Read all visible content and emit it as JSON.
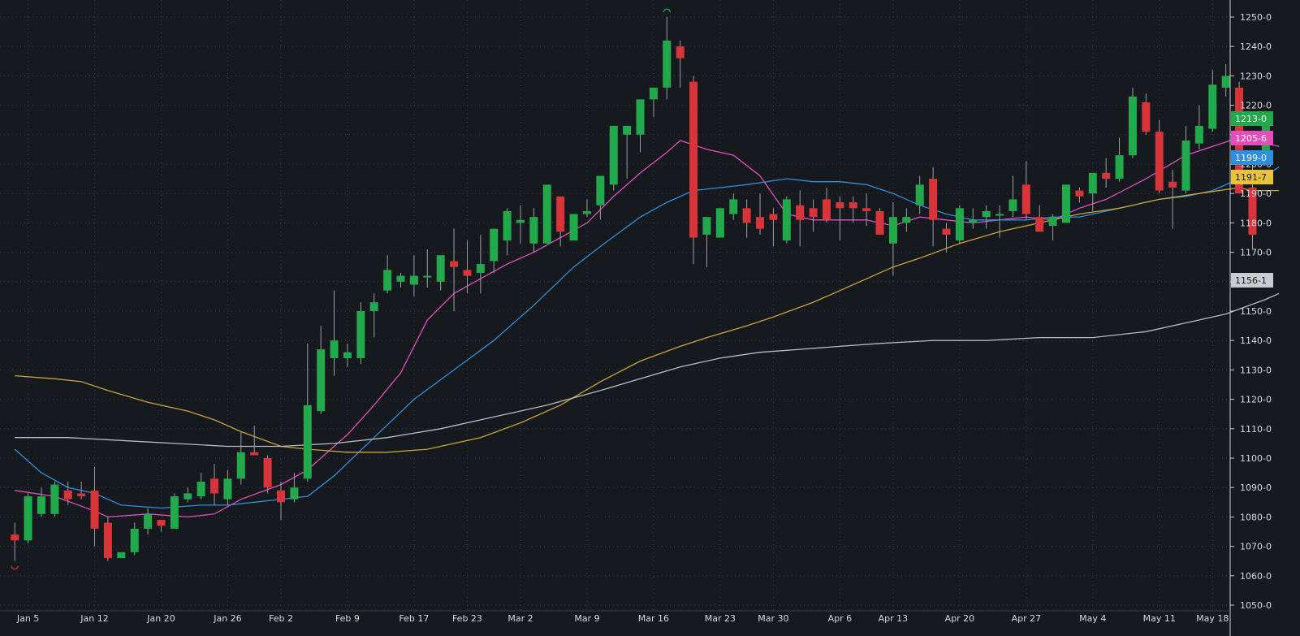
{
  "chart_data": {
    "type": "candlestick",
    "x_tick_labels": [
      "Jan 5",
      "Jan 12",
      "Jan 20",
      "Jan 26",
      "Feb 2",
      "Feb 9",
      "Feb 17",
      "Feb 23",
      "Mar 2",
      "Mar 9",
      "Mar 16",
      "Mar 23",
      "Mar 30",
      "Apr 6",
      "Apr 13",
      "Apr 20",
      "Apr 27",
      "May 4",
      "May 11",
      "May 18"
    ],
    "y_tick_labels": [
      "1250-0",
      "1240-0",
      "1230-0",
      "1220-0",
      "1210-0",
      "1200-0",
      "1190-0",
      "1180-0",
      "1170-0",
      "1160-0",
      "1150-0",
      "1140-0",
      "1130-0",
      "1120-0",
      "1110-0",
      "1100-0",
      "1090-0",
      "1080-0",
      "1070-0",
      "1060-0",
      "1050-0"
    ],
    "ylim": [
      1050,
      1253
    ],
    "grid": true,
    "colors": {
      "up": "#21a94b",
      "down": "#d9343a",
      "background": "#161a1e"
    },
    "candles": [
      {
        "o": 1074,
        "h": 1078,
        "l": 1065,
        "c": 1072
      },
      {
        "o": 1072,
        "h": 1088,
        "l": 1071,
        "c": 1087
      },
      {
        "o": 1081,
        "h": 1090,
        "l": 1080,
        "c": 1087
      },
      {
        "o": 1081,
        "h": 1092,
        "l": 1080,
        "c": 1091
      },
      {
        "o": 1089,
        "h": 1092,
        "l": 1084,
        "c": 1086
      },
      {
        "o": 1088,
        "h": 1092,
        "l": 1086,
        "c": 1087
      },
      {
        "o": 1089,
        "h": 1097,
        "l": 1070,
        "c": 1076
      },
      {
        "o": 1078,
        "h": 1080,
        "l": 1065,
        "c": 1066
      },
      {
        "o": 1066,
        "h": 1068,
        "l": 1066,
        "c": 1068
      },
      {
        "o": 1068,
        "h": 1078,
        "l": 1067,
        "c": 1076
      },
      {
        "o": 1076,
        "h": 1083,
        "l": 1074,
        "c": 1081
      },
      {
        "o": 1079,
        "h": 1079,
        "l": 1075,
        "c": 1077
      },
      {
        "o": 1076,
        "h": 1088,
        "l": 1076,
        "c": 1087
      },
      {
        "o": 1086,
        "h": 1090,
        "l": 1085,
        "c": 1088
      },
      {
        "o": 1087,
        "h": 1095,
        "l": 1086,
        "c": 1092
      },
      {
        "o": 1093,
        "h": 1098,
        "l": 1084,
        "c": 1088
      },
      {
        "o": 1086,
        "h": 1096,
        "l": 1084,
        "c": 1093
      },
      {
        "o": 1093,
        "h": 1109,
        "l": 1091,
        "c": 1102
      },
      {
        "o": 1102,
        "h": 1111,
        "l": 1101,
        "c": 1101
      },
      {
        "o": 1100,
        "h": 1101,
        "l": 1088,
        "c": 1090
      },
      {
        "o": 1089,
        "h": 1092,
        "l": 1079,
        "c": 1085
      },
      {
        "o": 1086,
        "h": 1095,
        "l": 1085,
        "c": 1090
      },
      {
        "o": 1093,
        "h": 1139,
        "l": 1092,
        "c": 1118
      },
      {
        "o": 1116,
        "h": 1145,
        "l": 1115,
        "c": 1137
      },
      {
        "o": 1134,
        "h": 1157,
        "l": 1128,
        "c": 1140
      },
      {
        "o": 1134,
        "h": 1139,
        "l": 1131,
        "c": 1136
      },
      {
        "o": 1134,
        "h": 1153,
        "l": 1132,
        "c": 1150
      },
      {
        "o": 1150,
        "h": 1156,
        "l": 1141,
        "c": 1153
      },
      {
        "o": 1157,
        "h": 1169,
        "l": 1156,
        "c": 1164
      },
      {
        "o": 1160,
        "h": 1163,
        "l": 1158,
        "c": 1162
      },
      {
        "o": 1159,
        "h": 1169,
        "l": 1155,
        "c": 1162
      },
      {
        "o": 1162,
        "h": 1171,
        "l": 1158,
        "c": 1162
      },
      {
        "o": 1160,
        "h": 1168,
        "l": 1157,
        "c": 1169
      },
      {
        "o": 1167,
        "h": 1178,
        "l": 1150,
        "c": 1165
      },
      {
        "o": 1164,
        "h": 1174,
        "l": 1156,
        "c": 1162
      },
      {
        "o": 1163,
        "h": 1176,
        "l": 1156,
        "c": 1166
      },
      {
        "o": 1167,
        "h": 1176,
        "l": 1163,
        "c": 1178
      },
      {
        "o": 1174,
        "h": 1185,
        "l": 1169,
        "c": 1184
      },
      {
        "o": 1180,
        "h": 1186,
        "l": 1173,
        "c": 1181
      },
      {
        "o": 1173,
        "h": 1185,
        "l": 1170,
        "c": 1182
      },
      {
        "o": 1173,
        "h": 1188,
        "l": 1173,
        "c": 1193
      },
      {
        "o": 1189,
        "h": 1189,
        "l": 1172,
        "c": 1177
      },
      {
        "o": 1174,
        "h": 1183,
        "l": 1174,
        "c": 1183
      },
      {
        "o": 1183,
        "h": 1188,
        "l": 1182,
        "c": 1184
      },
      {
        "o": 1186,
        "h": 1194,
        "l": 1181,
        "c": 1196
      },
      {
        "o": 1193,
        "h": 1206,
        "l": 1191,
        "c": 1213
      },
      {
        "o": 1210,
        "h": 1212,
        "l": 1195,
        "c": 1213
      },
      {
        "o": 1210,
        "h": 1214,
        "l": 1204,
        "c": 1222
      },
      {
        "o": 1222,
        "h": 1225,
        "l": 1216,
        "c": 1226
      },
      {
        "o": 1226,
        "h": 1250,
        "l": 1222,
        "c": 1242
      },
      {
        "o": 1240,
        "h": 1242,
        "l": 1226,
        "c": 1236
      },
      {
        "o": 1228,
        "h": 1230,
        "l": 1166,
        "c": 1175
      },
      {
        "o": 1176,
        "h": 1180,
        "l": 1165,
        "c": 1182
      },
      {
        "o": 1175,
        "h": 1183,
        "l": 1175,
        "c": 1185
      },
      {
        "o": 1183,
        "h": 1190,
        "l": 1181,
        "c": 1188
      },
      {
        "o": 1185,
        "h": 1188,
        "l": 1175,
        "c": 1180
      },
      {
        "o": 1182,
        "h": 1190,
        "l": 1176,
        "c": 1178
      },
      {
        "o": 1183,
        "h": 1185,
        "l": 1172,
        "c": 1181
      },
      {
        "o": 1174,
        "h": 1189,
        "l": 1173,
        "c": 1188
      },
      {
        "o": 1186,
        "h": 1191,
        "l": 1172,
        "c": 1181
      },
      {
        "o": 1185,
        "h": 1188,
        "l": 1177,
        "c": 1182
      },
      {
        "o": 1188,
        "h": 1192,
        "l": 1180,
        "c": 1181
      },
      {
        "o": 1187,
        "h": 1189,
        "l": 1174,
        "c": 1185
      },
      {
        "o": 1187,
        "h": 1189,
        "l": 1180,
        "c": 1185
      },
      {
        "o": 1185,
        "h": 1190,
        "l": 1179,
        "c": 1184
      },
      {
        "o": 1184,
        "h": 1185,
        "l": 1176,
        "c": 1176
      },
      {
        "o": 1173,
        "h": 1187,
        "l": 1162,
        "c": 1182
      },
      {
        "o": 1180,
        "h": 1185,
        "l": 1177,
        "c": 1182
      },
      {
        "o": 1186,
        "h": 1196,
        "l": 1183,
        "c": 1193
      },
      {
        "o": 1195,
        "h": 1199,
        "l": 1172,
        "c": 1181
      },
      {
        "o": 1178,
        "h": 1180,
        "l": 1170,
        "c": 1176
      },
      {
        "o": 1174,
        "h": 1186,
        "l": 1173,
        "c": 1185
      },
      {
        "o": 1180,
        "h": 1185,
        "l": 1178,
        "c": 1181
      },
      {
        "o": 1182,
        "h": 1186,
        "l": 1178,
        "c": 1184
      },
      {
        "o": 1183,
        "h": 1186,
        "l": 1175,
        "c": 1183
      },
      {
        "o": 1184,
        "h": 1196,
        "l": 1182,
        "c": 1188
      },
      {
        "o": 1193,
        "h": 1201,
        "l": 1181,
        "c": 1183
      },
      {
        "o": 1182,
        "h": 1186,
        "l": 1177,
        "c": 1177
      },
      {
        "o": 1179,
        "h": 1183,
        "l": 1174,
        "c": 1182
      },
      {
        "o": 1180,
        "h": 1193,
        "l": 1180,
        "c": 1193
      },
      {
        "o": 1191,
        "h": 1192,
        "l": 1187,
        "c": 1189
      },
      {
        "o": 1190,
        "h": 1195,
        "l": 1184,
        "c": 1197
      },
      {
        "o": 1197,
        "h": 1202,
        "l": 1192,
        "c": 1195
      },
      {
        "o": 1195,
        "h": 1209,
        "l": 1194,
        "c": 1203
      },
      {
        "o": 1203,
        "h": 1226,
        "l": 1202,
        "c": 1223
      },
      {
        "o": 1221,
        "h": 1224,
        "l": 1210,
        "c": 1211
      },
      {
        "o": 1211,
        "h": 1215,
        "l": 1190,
        "c": 1191
      },
      {
        "o": 1194,
        "h": 1198,
        "l": 1178,
        "c": 1192
      },
      {
        "o": 1191,
        "h": 1213,
        "l": 1190,
        "c": 1208
      },
      {
        "o": 1207,
        "h": 1220,
        "l": 1205,
        "c": 1213
      },
      {
        "o": 1212,
        "h": 1232,
        "l": 1211,
        "c": 1227
      },
      {
        "o": 1226,
        "h": 1234,
        "l": 1223,
        "c": 1230
      },
      {
        "o": 1226,
        "h": 1228,
        "l": 1190,
        "c": 1190
      },
      {
        "o": 1192,
        "h": 1200,
        "l": 1171,
        "c": 1176
      },
      {
        "o": 1203,
        "h": 1218,
        "l": 1201,
        "c": 1213
      }
    ],
    "candle_x_offset": 0.5,
    "moving_averages": [
      {
        "color": "#e24ebb",
        "points": [
          [
            0,
            1089
          ],
          [
            3,
            1087
          ],
          [
            6,
            1082
          ],
          [
            7,
            1080
          ],
          [
            10,
            1081
          ],
          [
            13,
            1080
          ],
          [
            15,
            1081
          ],
          [
            17,
            1086
          ],
          [
            20,
            1091
          ],
          [
            22,
            1096
          ],
          [
            25,
            1108
          ],
          [
            27,
            1118
          ],
          [
            29,
            1129
          ],
          [
            31,
            1147
          ],
          [
            33,
            1156
          ],
          [
            35,
            1161
          ],
          [
            37,
            1166
          ],
          [
            39,
            1170
          ],
          [
            41,
            1175
          ],
          [
            43,
            1180
          ],
          [
            45,
            1189
          ],
          [
            47,
            1197
          ],
          [
            49,
            1204
          ],
          [
            50,
            1208
          ],
          [
            52,
            1205
          ],
          [
            54,
            1203
          ],
          [
            56,
            1196
          ],
          [
            58,
            1183
          ],
          [
            60,
            1181
          ],
          [
            62,
            1181
          ],
          [
            64,
            1181
          ],
          [
            66,
            1179
          ],
          [
            68,
            1182
          ],
          [
            70,
            1181
          ],
          [
            72,
            1180
          ],
          [
            76,
            1182
          ],
          [
            78,
            1181
          ],
          [
            80,
            1185
          ],
          [
            82,
            1188
          ],
          [
            85,
            1195
          ],
          [
            88,
            1203
          ],
          [
            90,
            1206
          ],
          [
            92,
            1209
          ],
          [
            94,
            1207
          ],
          [
            95,
            1206
          ]
        ]
      },
      {
        "color": "#2e8fdc",
        "points": [
          [
            0,
            1103
          ],
          [
            2,
            1095
          ],
          [
            4,
            1090
          ],
          [
            6,
            1088
          ],
          [
            8,
            1084
          ],
          [
            11,
            1083
          ],
          [
            14,
            1084
          ],
          [
            16,
            1084
          ],
          [
            18,
            1085
          ],
          [
            20,
            1086
          ],
          [
            22,
            1087
          ],
          [
            24,
            1094
          ],
          [
            27,
            1107
          ],
          [
            30,
            1120
          ],
          [
            33,
            1130
          ],
          [
            36,
            1140
          ],
          [
            39,
            1152
          ],
          [
            42,
            1165
          ],
          [
            44,
            1172
          ],
          [
            47,
            1182
          ],
          [
            49,
            1187
          ],
          [
            51,
            1191
          ],
          [
            53,
            1192
          ],
          [
            55,
            1193
          ],
          [
            58,
            1195
          ],
          [
            60,
            1194
          ],
          [
            62,
            1194
          ],
          [
            64,
            1193
          ],
          [
            66,
            1190
          ],
          [
            68,
            1186
          ],
          [
            70,
            1183
          ],
          [
            72,
            1181
          ],
          [
            74,
            1181
          ],
          [
            76,
            1181
          ],
          [
            78,
            1182
          ],
          [
            80,
            1182
          ],
          [
            82,
            1184
          ],
          [
            84,
            1186
          ],
          [
            86,
            1188
          ],
          [
            88,
            1189
          ],
          [
            90,
            1191
          ],
          [
            92,
            1195
          ],
          [
            94,
            1196
          ],
          [
            95,
            1199
          ]
        ]
      },
      {
        "color": "#c9a43a",
        "points": [
          [
            0,
            1128
          ],
          [
            3,
            1127
          ],
          [
            5,
            1126
          ],
          [
            7,
            1123
          ],
          [
            10,
            1119
          ],
          [
            13,
            1116
          ],
          [
            15,
            1113
          ],
          [
            17,
            1109
          ],
          [
            20,
            1104
          ],
          [
            22,
            1103
          ],
          [
            25,
            1102
          ],
          [
            28,
            1102
          ],
          [
            31,
            1103
          ],
          [
            33,
            1105
          ],
          [
            35,
            1107
          ],
          [
            38,
            1112
          ],
          [
            41,
            1118
          ],
          [
            44,
            1126
          ],
          [
            47,
            1133
          ],
          [
            50,
            1138
          ],
          [
            52,
            1141
          ],
          [
            55,
            1145
          ],
          [
            57,
            1148
          ],
          [
            60,
            1153
          ],
          [
            62,
            1157
          ],
          [
            64,
            1161
          ],
          [
            66,
            1165
          ],
          [
            68,
            1168
          ],
          [
            71,
            1173
          ],
          [
            74,
            1177
          ],
          [
            77,
            1180
          ],
          [
            80,
            1183
          ],
          [
            83,
            1185
          ],
          [
            86,
            1188
          ],
          [
            89,
            1190
          ],
          [
            92,
            1192
          ],
          [
            93,
            1191
          ],
          [
            95,
            1191
          ]
        ]
      },
      {
        "color": "#b9bcbf",
        "points": [
          [
            0,
            1107
          ],
          [
            4,
            1107
          ],
          [
            8,
            1106
          ],
          [
            12,
            1105
          ],
          [
            16,
            1104
          ],
          [
            20,
            1104
          ],
          [
            24,
            1105
          ],
          [
            28,
            1107
          ],
          [
            32,
            1110
          ],
          [
            36,
            1114
          ],
          [
            40,
            1118
          ],
          [
            44,
            1123
          ],
          [
            47,
            1127
          ],
          [
            50,
            1131
          ],
          [
            53,
            1134
          ],
          [
            56,
            1136
          ],
          [
            59,
            1137
          ],
          [
            62,
            1138
          ],
          [
            65,
            1139
          ],
          [
            69,
            1140
          ],
          [
            73,
            1140
          ],
          [
            77,
            1141
          ],
          [
            81,
            1141
          ],
          [
            85,
            1143
          ],
          [
            88,
            1146
          ],
          [
            91,
            1149
          ],
          [
            94,
            1154
          ],
          [
            95,
            1156
          ]
        ]
      }
    ],
    "price_tags": [
      {
        "label": "1213-0",
        "value": 1213,
        "bg": "#21a94b",
        "fg": "#ffffff"
      },
      {
        "label": "1205-6",
        "value": 1205.6,
        "bg": "#e24ebb",
        "fg": "#ffffff"
      },
      {
        "label": "1199-0",
        "value": 1199,
        "bg": "#2e8fdc",
        "fg": "#ffffff"
      },
      {
        "label": "1191-7",
        "value": 1191.7,
        "bg": "#e8c23a",
        "fg": "#1a1a1a"
      },
      {
        "label": "1156-1",
        "value": 1156.1,
        "bg": "#c9ccd0",
        "fg": "#1a1a1a"
      }
    ],
    "markers": [
      {
        "type": "low",
        "candle": 0,
        "value": 1065,
        "color": "#d9343a"
      },
      {
        "type": "high",
        "candle": 49,
        "value": 1250,
        "color": "#21a94b"
      }
    ]
  }
}
